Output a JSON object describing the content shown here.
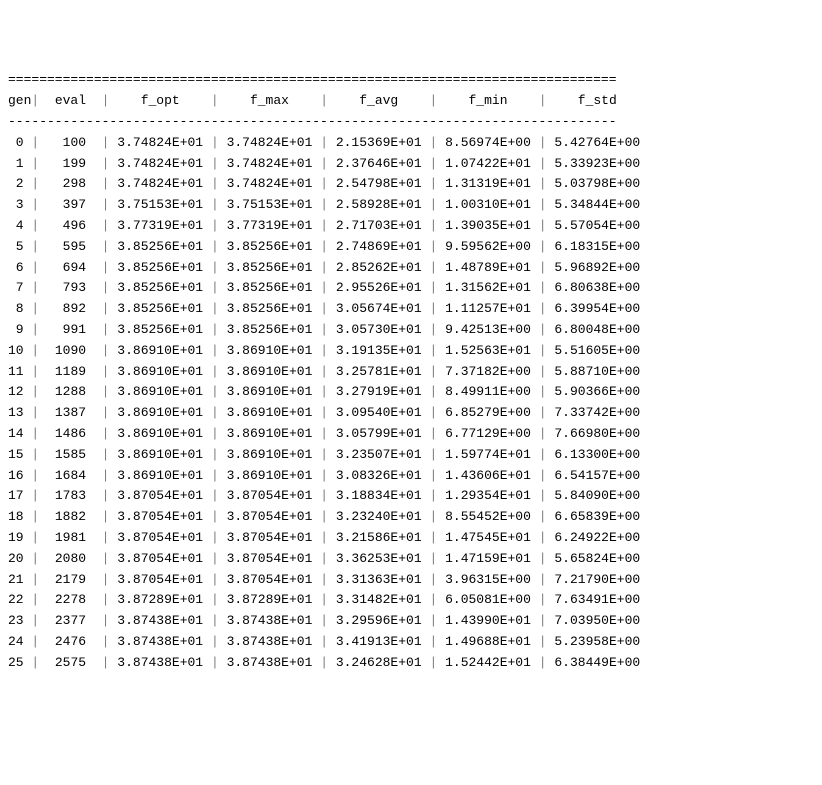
{
  "border_top": "==============================================================================",
  "border_dash": "------------------------------------------------------------------------------",
  "header": {
    "gen": "gen",
    "eval": "eval",
    "f_opt": "f_opt",
    "f_max": "f_max",
    "f_avg": "f_avg",
    "f_min": "f_min",
    "f_std": "f_std"
  },
  "rows": [
    {
      "gen": " 0",
      "eval": "  100 ",
      "f_opt": "3.74824E+01",
      "f_max": "3.74824E+01",
      "f_avg": "2.15369E+01",
      "f_min": "8.56974E+00",
      "f_std": "5.42764E+00"
    },
    {
      "gen": " 1",
      "eval": "  199 ",
      "f_opt": "3.74824E+01",
      "f_max": "3.74824E+01",
      "f_avg": "2.37646E+01",
      "f_min": "1.07422E+01",
      "f_std": "5.33923E+00"
    },
    {
      "gen": " 2",
      "eval": "  298 ",
      "f_opt": "3.74824E+01",
      "f_max": "3.74824E+01",
      "f_avg": "2.54798E+01",
      "f_min": "1.31319E+01",
      "f_std": "5.03798E+00"
    },
    {
      "gen": " 3",
      "eval": "  397 ",
      "f_opt": "3.75153E+01",
      "f_max": "3.75153E+01",
      "f_avg": "2.58928E+01",
      "f_min": "1.00310E+01",
      "f_std": "5.34844E+00"
    },
    {
      "gen": " 4",
      "eval": "  496 ",
      "f_opt": "3.77319E+01",
      "f_max": "3.77319E+01",
      "f_avg": "2.71703E+01",
      "f_min": "1.39035E+01",
      "f_std": "5.57054E+00"
    },
    {
      "gen": " 5",
      "eval": "  595 ",
      "f_opt": "3.85256E+01",
      "f_max": "3.85256E+01",
      "f_avg": "2.74869E+01",
      "f_min": "9.59562E+00",
      "f_std": "6.18315E+00"
    },
    {
      "gen": " 6",
      "eval": "  694 ",
      "f_opt": "3.85256E+01",
      "f_max": "3.85256E+01",
      "f_avg": "2.85262E+01",
      "f_min": "1.48789E+01",
      "f_std": "5.96892E+00"
    },
    {
      "gen": " 7",
      "eval": "  793 ",
      "f_opt": "3.85256E+01",
      "f_max": "3.85256E+01",
      "f_avg": "2.95526E+01",
      "f_min": "1.31562E+01",
      "f_std": "6.80638E+00"
    },
    {
      "gen": " 8",
      "eval": "  892 ",
      "f_opt": "3.85256E+01",
      "f_max": "3.85256E+01",
      "f_avg": "3.05674E+01",
      "f_min": "1.11257E+01",
      "f_std": "6.39954E+00"
    },
    {
      "gen": " 9",
      "eval": "  991 ",
      "f_opt": "3.85256E+01",
      "f_max": "3.85256E+01",
      "f_avg": "3.05730E+01",
      "f_min": "9.42513E+00",
      "f_std": "6.80048E+00"
    },
    {
      "gen": "10",
      "eval": " 1090 ",
      "f_opt": "3.86910E+01",
      "f_max": "3.86910E+01",
      "f_avg": "3.19135E+01",
      "f_min": "1.52563E+01",
      "f_std": "5.51605E+00"
    },
    {
      "gen": "11",
      "eval": " 1189 ",
      "f_opt": "3.86910E+01",
      "f_max": "3.86910E+01",
      "f_avg": "3.25781E+01",
      "f_min": "7.37182E+00",
      "f_std": "5.88710E+00"
    },
    {
      "gen": "12",
      "eval": " 1288 ",
      "f_opt": "3.86910E+01",
      "f_max": "3.86910E+01",
      "f_avg": "3.27919E+01",
      "f_min": "8.49911E+00",
      "f_std": "5.90366E+00"
    },
    {
      "gen": "13",
      "eval": " 1387 ",
      "f_opt": "3.86910E+01",
      "f_max": "3.86910E+01",
      "f_avg": "3.09540E+01",
      "f_min": "6.85279E+00",
      "f_std": "7.33742E+00"
    },
    {
      "gen": "14",
      "eval": " 1486 ",
      "f_opt": "3.86910E+01",
      "f_max": "3.86910E+01",
      "f_avg": "3.05799E+01",
      "f_min": "6.77129E+00",
      "f_std": "7.66980E+00"
    },
    {
      "gen": "15",
      "eval": " 1585 ",
      "f_opt": "3.86910E+01",
      "f_max": "3.86910E+01",
      "f_avg": "3.23507E+01",
      "f_min": "1.59774E+01",
      "f_std": "6.13300E+00"
    },
    {
      "gen": "16",
      "eval": " 1684 ",
      "f_opt": "3.86910E+01",
      "f_max": "3.86910E+01",
      "f_avg": "3.08326E+01",
      "f_min": "1.43606E+01",
      "f_std": "6.54157E+00"
    },
    {
      "gen": "17",
      "eval": " 1783 ",
      "f_opt": "3.87054E+01",
      "f_max": "3.87054E+01",
      "f_avg": "3.18834E+01",
      "f_min": "1.29354E+01",
      "f_std": "5.84090E+00"
    },
    {
      "gen": "18",
      "eval": " 1882 ",
      "f_opt": "3.87054E+01",
      "f_max": "3.87054E+01",
      "f_avg": "3.23240E+01",
      "f_min": "8.55452E+00",
      "f_std": "6.65839E+00"
    },
    {
      "gen": "19",
      "eval": " 1981 ",
      "f_opt": "3.87054E+01",
      "f_max": "3.87054E+01",
      "f_avg": "3.21586E+01",
      "f_min": "1.47545E+01",
      "f_std": "6.24922E+00"
    },
    {
      "gen": "20",
      "eval": " 2080 ",
      "f_opt": "3.87054E+01",
      "f_max": "3.87054E+01",
      "f_avg": "3.36253E+01",
      "f_min": "1.47159E+01",
      "f_std": "5.65824E+00"
    },
    {
      "gen": "21",
      "eval": " 2179 ",
      "f_opt": "3.87054E+01",
      "f_max": "3.87054E+01",
      "f_avg": "3.31363E+01",
      "f_min": "3.96315E+00",
      "f_std": "7.21790E+00"
    },
    {
      "gen": "22",
      "eval": " 2278 ",
      "f_opt": "3.87289E+01",
      "f_max": "3.87289E+01",
      "f_avg": "3.31482E+01",
      "f_min": "6.05081E+00",
      "f_std": "7.63491E+00"
    },
    {
      "gen": "23",
      "eval": " 2377 ",
      "f_opt": "3.87438E+01",
      "f_max": "3.87438E+01",
      "f_avg": "3.29596E+01",
      "f_min": "1.43990E+01",
      "f_std": "7.03950E+00"
    },
    {
      "gen": "24",
      "eval": " 2476 ",
      "f_opt": "3.87438E+01",
      "f_max": "3.87438E+01",
      "f_avg": "3.41913E+01",
      "f_min": "1.49688E+01",
      "f_std": "5.23958E+00"
    },
    {
      "gen": "25",
      "eval": " 2575 ",
      "f_opt": "3.87438E+01",
      "f_max": "3.87438E+01",
      "f_avg": "3.24628E+01",
      "f_min": "1.52442E+01",
      "f_std": "6.38449E+00"
    }
  ]
}
